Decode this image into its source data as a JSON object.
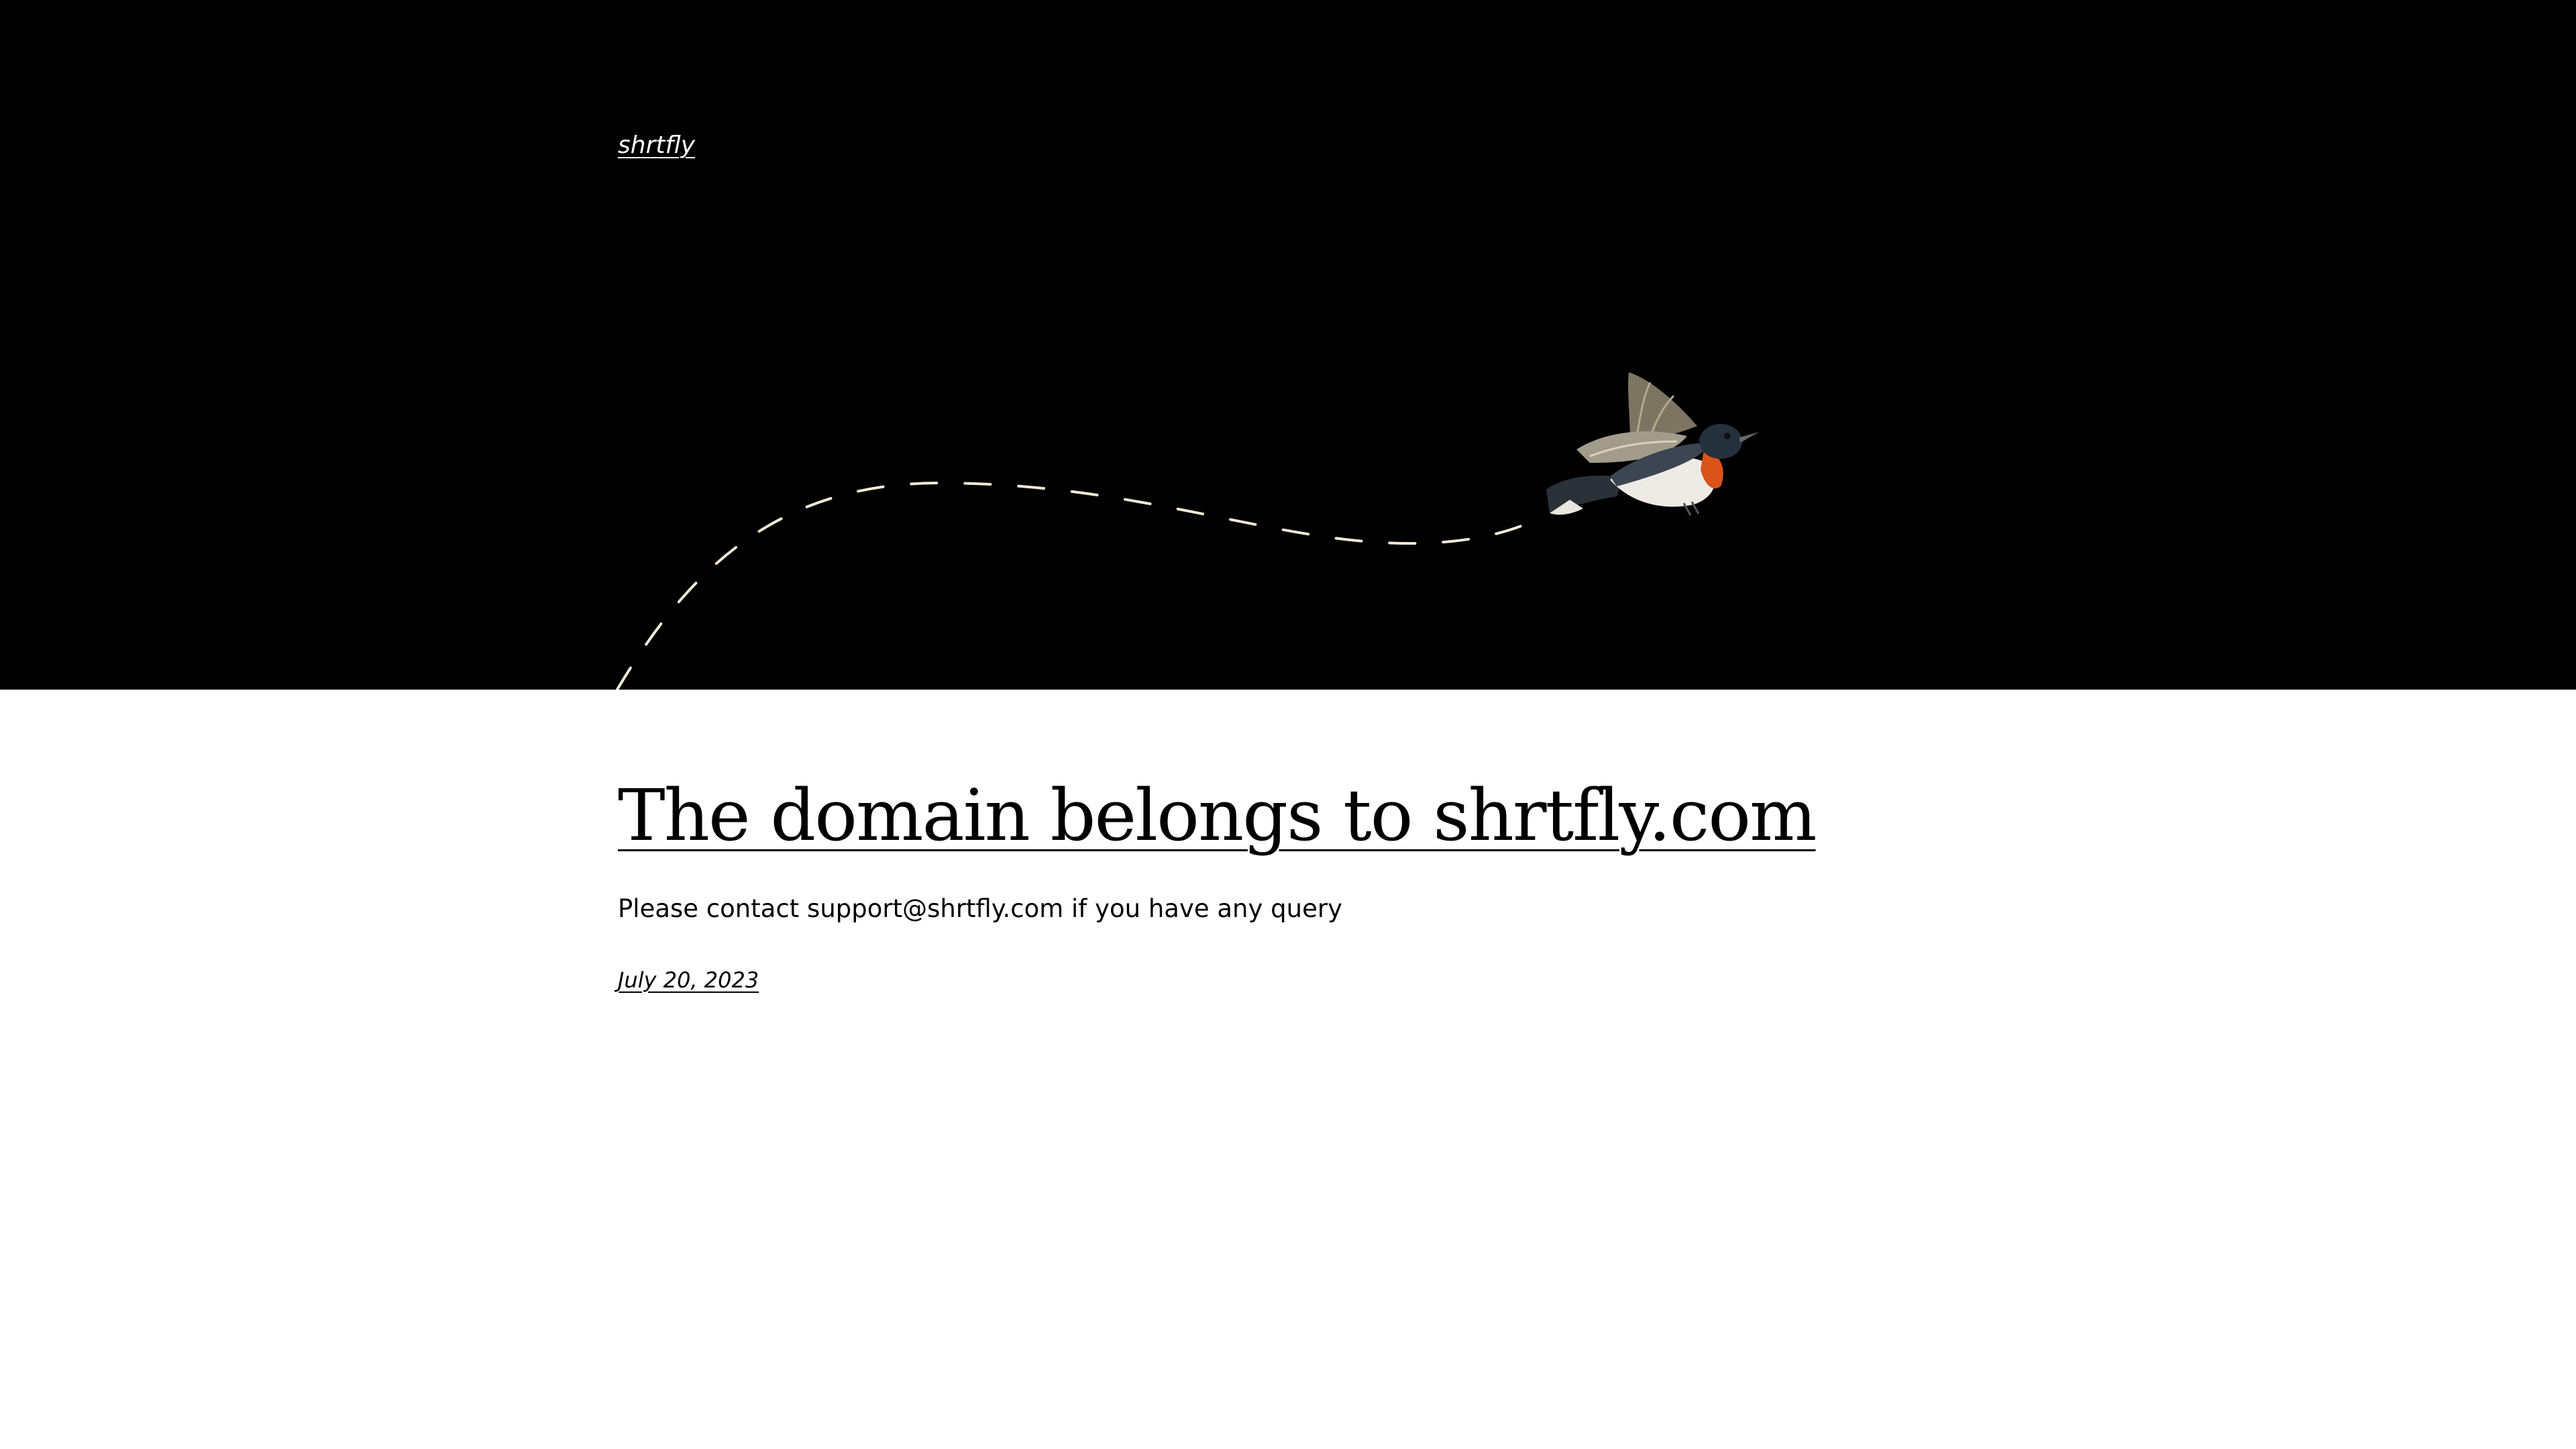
{
  "site": {
    "title": "shrtfly"
  },
  "post": {
    "title": "The domain belongs to shrtfly.com",
    "excerpt": "Please contact support@shrtfly.com if you have any query",
    "date": "July 20, 2023"
  },
  "header": {
    "illustration_icon": "bird-icon",
    "path_icon": "dashed-flight-path-icon",
    "background_color": "#000000"
  }
}
